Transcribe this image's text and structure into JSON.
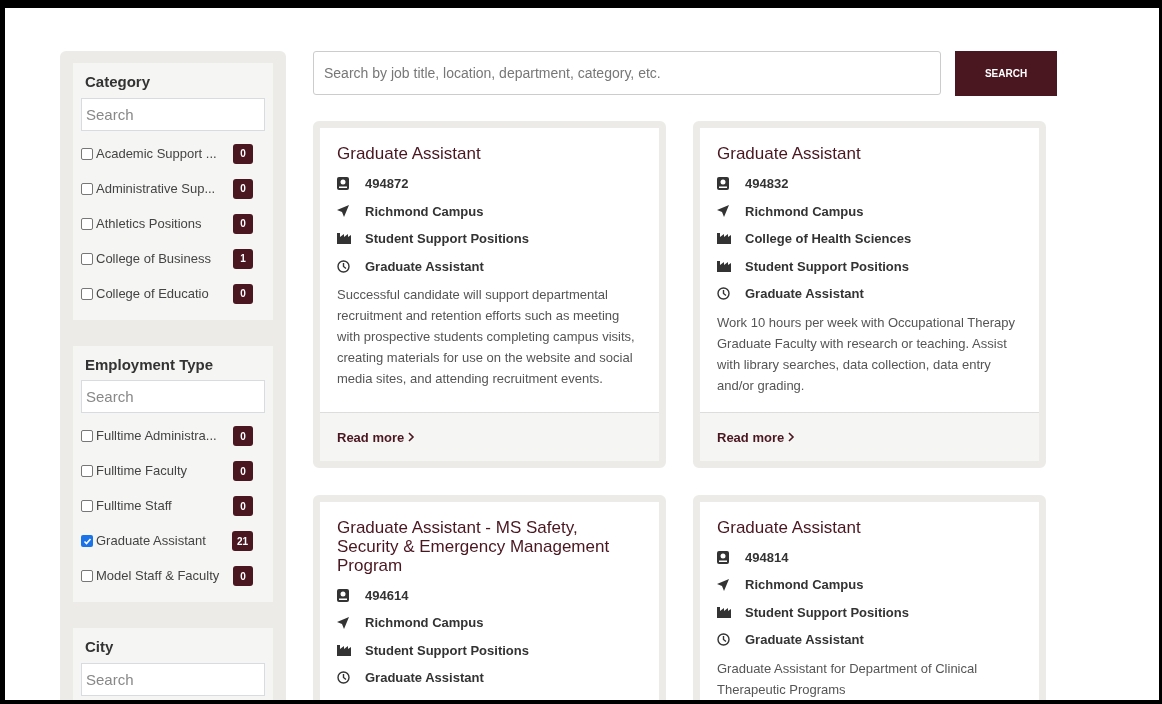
{
  "filters": [
    {
      "title": "Category",
      "search": {
        "placeholder": "Search"
      },
      "options": [
        {
          "label": "Academic Support ...",
          "checked": false,
          "count": "0"
        },
        {
          "label": "Administrative Sup...",
          "checked": false,
          "count": "0"
        },
        {
          "label": "Athletics Positions",
          "checked": false,
          "count": "0"
        },
        {
          "label": "College of Business",
          "checked": false,
          "count": "1"
        },
        {
          "label": "College of Educatio",
          "checked": false,
          "count": "0"
        }
      ]
    },
    {
      "title": "Employment Type",
      "search": {
        "placeholder": "Search"
      },
      "options": [
        {
          "label": "Fulltime Administra...",
          "checked": false,
          "count": "0"
        },
        {
          "label": "Fulltime Faculty",
          "checked": false,
          "count": "0"
        },
        {
          "label": "Fulltime Staff",
          "checked": false,
          "count": "0"
        },
        {
          "label": "Graduate Assistant",
          "checked": true,
          "count": "21"
        },
        {
          "label": "Model Staff & Faculty",
          "checked": false,
          "count": "0"
        }
      ]
    },
    {
      "title": "City",
      "search": {
        "placeholder": "Search"
      }
    }
  ],
  "search": {
    "placeholder": "Search by job title, location, department, category, etc.",
    "button": "SEARCH"
  },
  "jobs": [
    {
      "title": "Graduate Assistant",
      "details": [
        {
          "kind": "id",
          "text": "494872"
        },
        {
          "kind": "location",
          "text": "Richmond Campus"
        },
        {
          "kind": "department",
          "text": "Student Support Positions"
        },
        {
          "kind": "type",
          "text": "Graduate Assistant"
        }
      ],
      "description": "Successful candidate will support departmental recruitment and retention efforts such as meeting with prospective students completing campus visits, creating materials for use on the website and social media sites, and attending recruitment events.",
      "link": "Read more"
    },
    {
      "title": "Graduate Assistant",
      "details": [
        {
          "kind": "id",
          "text": "494832"
        },
        {
          "kind": "location",
          "text": "Richmond Campus"
        },
        {
          "kind": "department",
          "text": "College of Health Sciences"
        },
        {
          "kind": "department",
          "text": "Student Support Positions"
        },
        {
          "kind": "type",
          "text": "Graduate Assistant"
        }
      ],
      "description": "Work 10 hours per week with Occupational Therapy Graduate Faculty with research or teaching. Assist with library searches, data collection, data entry and/or grading.",
      "link": "Read more"
    },
    {
      "title": "Graduate Assistant - MS Safety, Security & Emergency Management Program",
      "details": [
        {
          "kind": "id",
          "text": "494614"
        },
        {
          "kind": "location",
          "text": "Richmond Campus"
        },
        {
          "kind": "department",
          "text": "Student Support Positions"
        },
        {
          "kind": "type",
          "text": "Graduate Assistant"
        }
      ]
    },
    {
      "title": "Graduate Assistant",
      "details": [
        {
          "kind": "id",
          "text": "494814"
        },
        {
          "kind": "location",
          "text": "Richmond Campus"
        },
        {
          "kind": "department",
          "text": "Student Support Positions"
        },
        {
          "kind": "type",
          "text": "Graduate Assistant"
        }
      ],
      "description": "Graduate Assistant for Department of Clinical Therapeutic Programs"
    }
  ]
}
